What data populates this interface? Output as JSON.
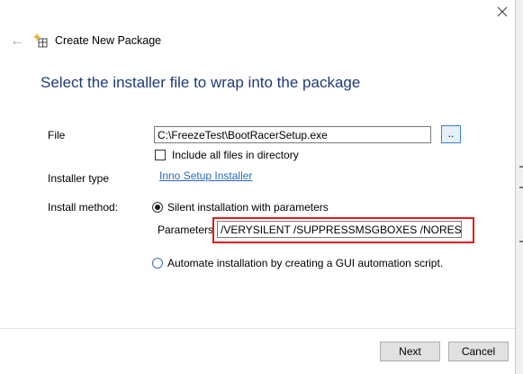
{
  "window": {
    "title": "Create New Package",
    "back_icon": "back-arrow-icon",
    "close_icon": "close-icon"
  },
  "heading": "Select the installer file to wrap into the package",
  "file": {
    "label": "File",
    "value": "C:\\FreezeTest\\BootRacerSetup.exe",
    "browse_label": "..",
    "include_all_label": "Include all files in directory",
    "include_all_checked": false
  },
  "installer_type": {
    "label": "Installer type",
    "value": "Inno Setup Installer"
  },
  "install_method": {
    "label": "Install method:",
    "silent_label": "Silent installation with parameters",
    "silent_selected": true,
    "parameters_label": "Parameters",
    "parameters_value": "/VERYSILENT /SUPPRESSMSGBOXES /NORES",
    "automate_label": "Automate installation by creating a GUI automation script.",
    "automate_selected": false
  },
  "footer": {
    "next_label": "Next",
    "cancel_label": "Cancel"
  },
  "colors": {
    "heading": "#1e3a78",
    "link": "#2a6ac2",
    "highlight_box": "#e21a1a"
  }
}
